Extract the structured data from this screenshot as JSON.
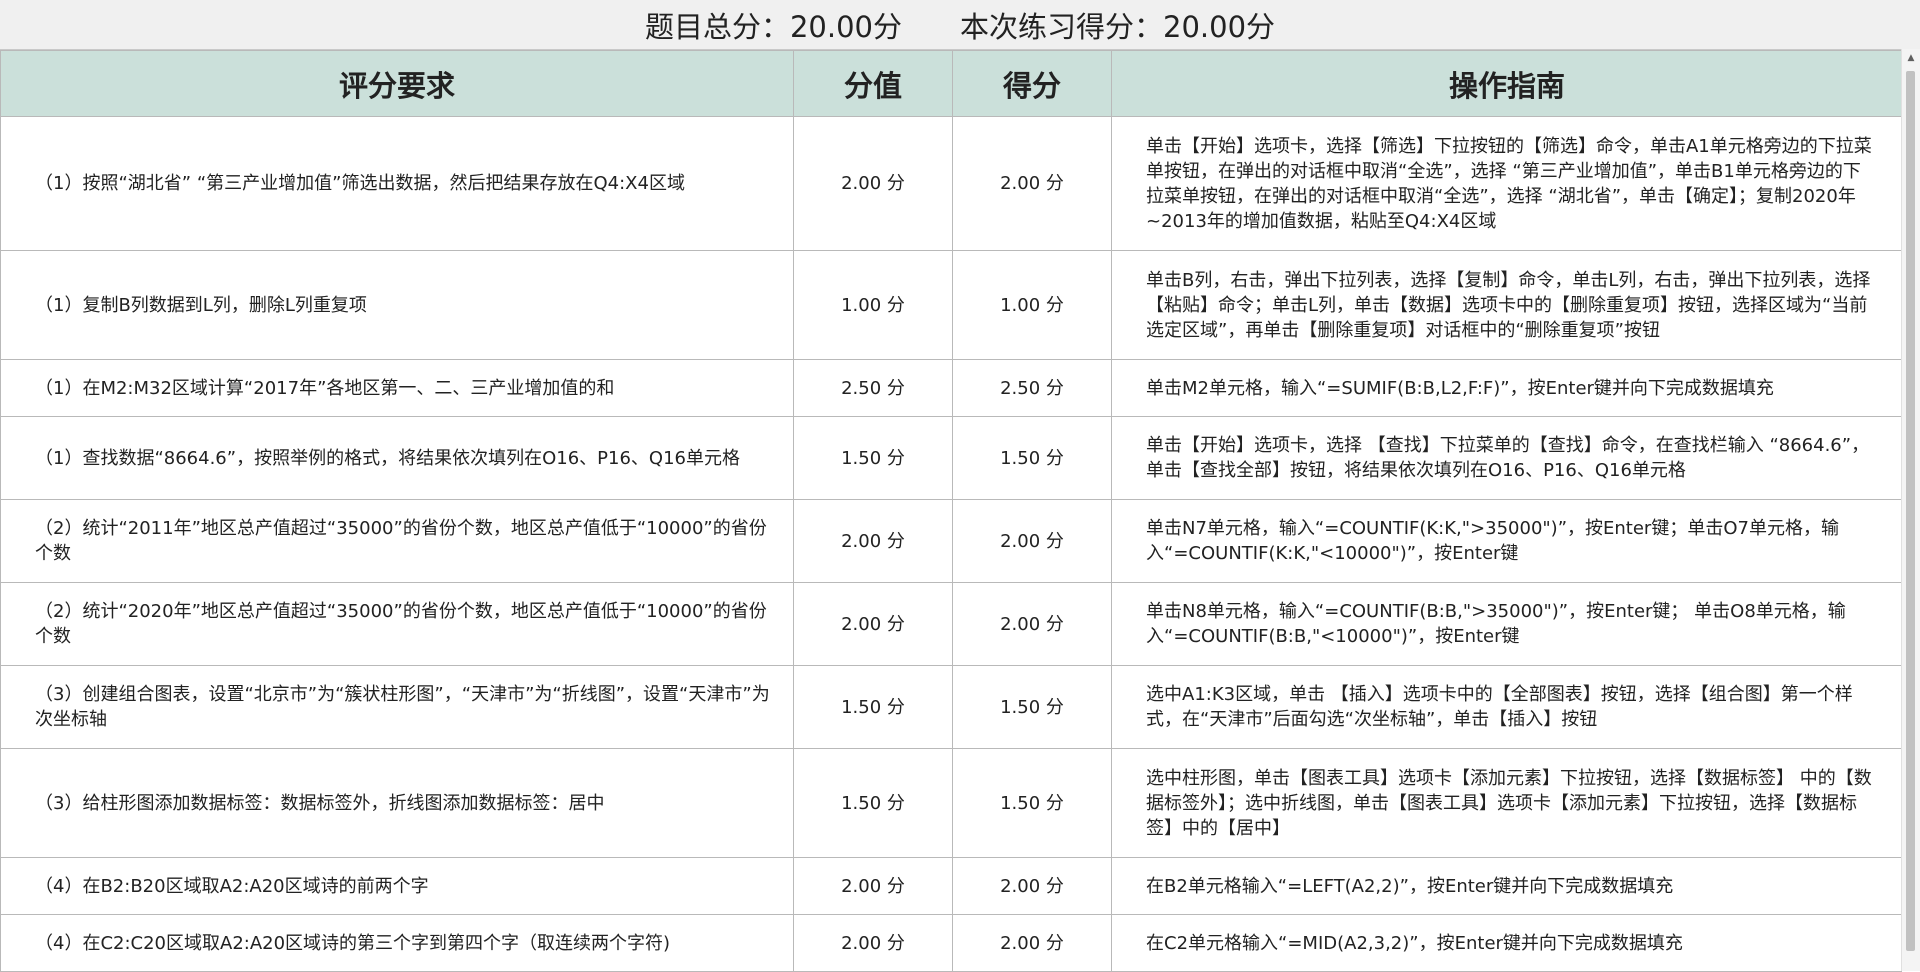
{
  "summary": {
    "total_label": "题目总分：20.00分",
    "score_label": "本次练习得分：20.00分"
  },
  "table": {
    "headers": {
      "requirement": "评分要求",
      "points": "分值",
      "score": "得分",
      "guide": "操作指南"
    },
    "rows": [
      {
        "requirement": "（1）按照“湖北省” “第三产业增加值”筛选出数据，然后把结果存放在Q4:X4区域",
        "points": "2.00 分",
        "score": "2.00 分",
        "guide": "单击【开始】选项卡，选择【筛选】下拉按钮的【筛选】命令，单击A1单元格旁边的下拉菜单按钮，在弹出的对话框中取消“全选”，选择 “第三产业增加值”，单击B1单元格旁边的下拉菜单按钮，在弹出的对话框中取消“全选”，选择 “湖北省”，单击【确定】；复制2020年~2013年的增加值数据，粘贴至Q4:X4区域"
      },
      {
        "requirement": "（1）复制B列数据到L列，删除L列重复项",
        "points": "1.00 分",
        "score": "1.00 分",
        "guide": "单击B列，右击，弹出下拉列表，选择【复制】命令，单击L列，右击，弹出下拉列表，选择【粘贴】命令；单击L列，单击【数据】选项卡中的【删除重复项】按钮，选择区域为“当前选定区域”，再单击【删除重复项】对话框中的“删除重复项”按钮"
      },
      {
        "requirement": "（1）在M2:M32区域计算“2017年”各地区第一、二、三产业增加值的和",
        "points": "2.50 分",
        "score": "2.50 分",
        "guide": "单击M2单元格，输入“=SUMIF(B:B,L2,F:F)”，按Enter键并向下完成数据填充"
      },
      {
        "requirement": "（1）查找数据“8664.6”，按照举例的格式，将结果依次填列在O16、P16、Q16单元格",
        "points": "1.50 分",
        "score": "1.50 分",
        "guide": "单击【开始】选项卡，选择 【查找】下拉菜单的【查找】命令，在查找栏输入 “8664.6”，单击【查找全部】按钮，将结果依次填列在O16、P16、Q16单元格"
      },
      {
        "requirement": "（2）统计“2011年”地区总产值超过“35000”的省份个数，地区总产值低于“10000”的省份个数",
        "points": "2.00 分",
        "score": "2.00 分",
        "guide": "单击N7单元格，输入“=COUNTIF(K:K,\">35000\")”，按Enter键；单击O7单元格，输入“=COUNTIF(K:K,\"<10000\")”，按Enter键"
      },
      {
        "requirement": "（2）统计“2020年”地区总产值超过“35000”的省份个数，地区总产值低于“10000”的省份个数",
        "points": "2.00 分",
        "score": "2.00 分",
        "guide": "单击N8单元格，输入“=COUNTIF(B:B,\">35000\")”，按Enter键； 单击O8单元格，输入“=COUNTIF(B:B,\"<10000\")”，按Enter键"
      },
      {
        "requirement": "（3）创建组合图表，设置“北京市”为“簇状柱形图”，“天津市”为“折线图”，设置“天津市”为次坐标轴",
        "points": "1.50 分",
        "score": "1.50 分",
        "guide": "选中A1:K3区域，单击 【插入】选项卡中的【全部图表】按钮，选择【组合图】第一个样式，在“天津市”后面勾选“次坐标轴”，单击【插入】按钮"
      },
      {
        "requirement": "（3）给柱形图添加数据标签：数据标签外，折线图添加数据标签：居中",
        "points": "1.50 分",
        "score": "1.50 分",
        "guide": "选中柱形图，单击【图表工具】选项卡【添加元素】下拉按钮，选择【数据标签】 中的【数据标签外】；选中折线图，单击【图表工具】选项卡【添加元素】下拉按钮，选择【数据标签】中的【居中】"
      },
      {
        "requirement": "（4）在B2:B20区域取A2:A20区域诗的前两个字",
        "points": "2.00 分",
        "score": "2.00 分",
        "guide": "在B2单元格输入“=LEFT(A2,2)”，按Enter键并向下完成数据填充"
      },
      {
        "requirement": "（4）在C2:C20区域取A2:A20区域诗的第三个字到第四个字（取连续两个字符)",
        "points": "2.00 分",
        "score": "2.00 分",
        "guide": "在C2单元格输入“=MID(A2,3,2)”，按Enter键并向下完成数据填充"
      }
    ]
  },
  "colors": {
    "header_bg": "#cbe0da",
    "top_bg": "#f0f0f0",
    "border": "#b9b9b9"
  },
  "icons": {
    "scroll_up": "chevron-up-icon"
  }
}
